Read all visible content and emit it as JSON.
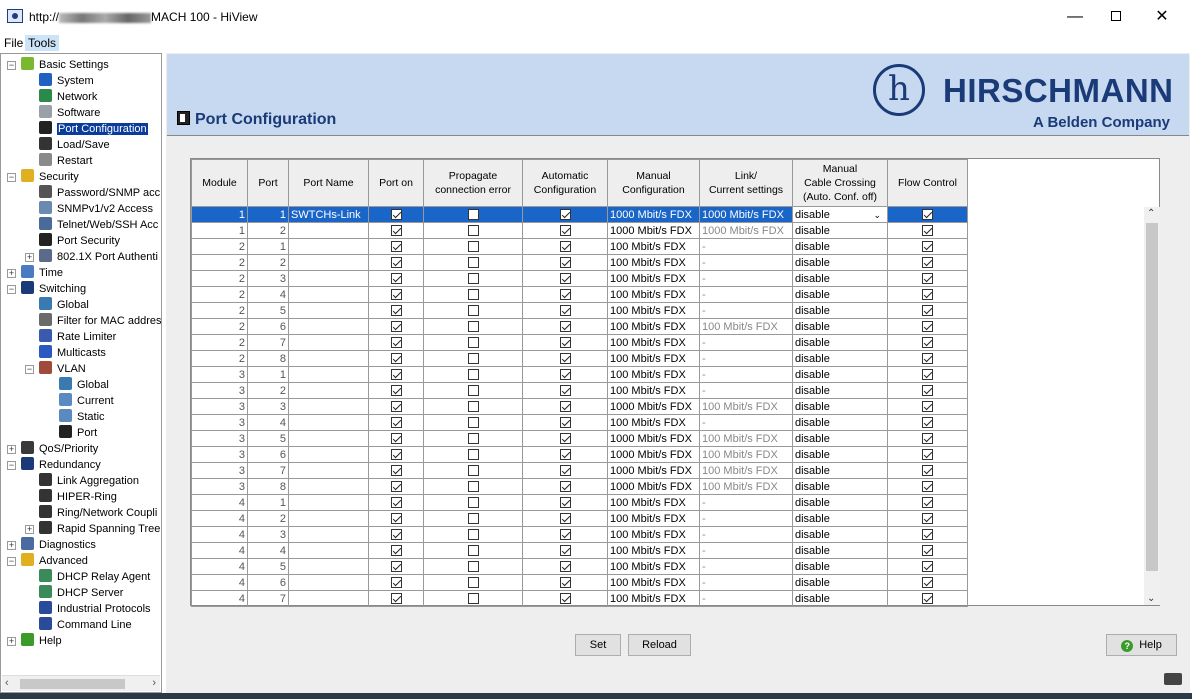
{
  "window": {
    "title_prefix": "http://",
    "title_suffix": "MACH 100 - HiView",
    "minimize": "—",
    "close": "✕"
  },
  "menu": {
    "file": "File",
    "tools": "Tools"
  },
  "tree": [
    {
      "label": "Basic Settings",
      "level": 0,
      "icon": "star-icon",
      "color": "#7cb82f",
      "expander": "−"
    },
    {
      "label": "System",
      "level": 1,
      "icon": "info-icon",
      "color": "#2060c0"
    },
    {
      "label": "Network",
      "level": 1,
      "icon": "network-icon",
      "color": "#2a8a4a"
    },
    {
      "label": "Software",
      "level": 1,
      "icon": "software-icon",
      "color": "#9aa0a8"
    },
    {
      "label": "Port Configuration",
      "level": 1,
      "icon": "port-icon",
      "color": "#222222",
      "selected": true
    },
    {
      "label": "Load/Save",
      "level": 1,
      "icon": "save-icon",
      "color": "#333333"
    },
    {
      "label": "Restart",
      "level": 1,
      "icon": "restart-icon",
      "color": "#8a8a8a"
    },
    {
      "label": "Security",
      "level": 0,
      "icon": "lock-icon",
      "color": "#e0b020",
      "expander": "−"
    },
    {
      "label": "Password/SNMP acc",
      "level": 1,
      "icon": "pin-icon",
      "color": "#555555"
    },
    {
      "label": "SNMPv1/v2 Access",
      "level": 1,
      "icon": "snmp-icon",
      "color": "#6a8ab0"
    },
    {
      "label": "Telnet/Web/SSH Acc",
      "level": 1,
      "icon": "terminal-icon",
      "color": "#4a6a9a"
    },
    {
      "label": "Port Security",
      "level": 1,
      "icon": "port-security-icon",
      "color": "#222222"
    },
    {
      "label": "802.1X Port Authenti",
      "level": 1,
      "icon": "dot1x-icon",
      "color": "#5a6a8a",
      "expander": "+"
    },
    {
      "label": "Time",
      "level": 0,
      "icon": "clock-icon",
      "color": "#4a7ac0",
      "expander": "+"
    },
    {
      "label": "Switching",
      "level": 0,
      "icon": "switching-icon",
      "color": "#1a3a78",
      "expander": "−"
    },
    {
      "label": "Global",
      "level": 1,
      "icon": "global-icon",
      "color": "#3a7ab0"
    },
    {
      "label": "Filter for MAC addres",
      "level": 1,
      "icon": "filter-icon",
      "color": "#6a6a6a"
    },
    {
      "label": "Rate Limiter",
      "level": 1,
      "icon": "rate-limiter-icon",
      "color": "#3a5ab0"
    },
    {
      "label": "Multicasts",
      "level": 1,
      "icon": "multicast-icon",
      "color": "#2a5ac0"
    },
    {
      "label": "VLAN",
      "level": 1,
      "icon": "vlan-icon",
      "color": "#a04a3a",
      "expander": "−"
    },
    {
      "label": "Global",
      "level": 2,
      "icon": "vlan-global-icon",
      "color": "#3a7ab0"
    },
    {
      "label": "Current",
      "level": 2,
      "icon": "vlan-current-icon",
      "color": "#5a8ac0"
    },
    {
      "label": "Static",
      "level": 2,
      "icon": "vlan-static-icon",
      "color": "#5a8ac0"
    },
    {
      "label": "Port",
      "level": 2,
      "icon": "vlan-port-icon",
      "color": "#222222"
    },
    {
      "label": "QoS/Priority",
      "level": 0,
      "icon": "qos-icon",
      "color": "#3a3a3a",
      "expander": "+"
    },
    {
      "label": "Redundancy",
      "level": 0,
      "icon": "redundancy-icon",
      "color": "#1a3a78",
      "expander": "−"
    },
    {
      "label": "Link Aggregation",
      "level": 1,
      "icon": "link-aggregation-icon",
      "color": "#333333"
    },
    {
      "label": "HIPER-Ring",
      "level": 1,
      "icon": "ring-icon",
      "color": "#333333"
    },
    {
      "label": "Ring/Network Coupli",
      "level": 1,
      "icon": "ring-coupling-icon",
      "color": "#333333"
    },
    {
      "label": "Rapid Spanning Tree",
      "level": 1,
      "icon": "spanning-tree-icon",
      "color": "#333333",
      "expander": "+"
    },
    {
      "label": "Diagnostics",
      "level": 0,
      "icon": "diagnostics-icon",
      "color": "#4a6aa0",
      "expander": "+"
    },
    {
      "label": "Advanced",
      "level": 0,
      "icon": "advanced-icon",
      "color": "#e0b020",
      "expander": "−"
    },
    {
      "label": "DHCP Relay Agent",
      "level": 1,
      "icon": "dhcp-relay-icon",
      "color": "#3a8a5a"
    },
    {
      "label": "DHCP Server",
      "level": 1,
      "icon": "dhcp-server-icon",
      "color": "#3a8a5a"
    },
    {
      "label": "Industrial Protocols",
      "level": 1,
      "icon": "protocols-icon",
      "color": "#2a4a9a"
    },
    {
      "label": "Command Line",
      "level": 1,
      "icon": "command-line-icon",
      "color": "#2a4a9a"
    },
    {
      "label": "Help",
      "level": 0,
      "icon": "help-icon",
      "color": "#3a9a2a",
      "expander": "+"
    }
  ],
  "brand": {
    "logo_letter": "h",
    "name": "HIRSCHMANN",
    "subtitle": "A Belden Company"
  },
  "page": {
    "title": "Port Configuration"
  },
  "table": {
    "headers": [
      "Module",
      "Port",
      "Port Name",
      "Port on",
      "Propagate\nconnection error",
      "Automatic\nConfiguration",
      "Manual\nConfiguration",
      "Link/\nCurrent settings",
      "Manual\nCable Crossing\n(Auto. Conf. off)",
      "Flow Control"
    ],
    "rows": [
      {
        "module": "1",
        "port": "1",
        "name": "SWTCHs-Link",
        "port_on": true,
        "propagate": false,
        "auto": true,
        "manual": "1000 Mbit/s FDX",
        "link": "1000 Mbit/s FDX",
        "crossing": "disable",
        "flow": true,
        "selected": true
      },
      {
        "module": "1",
        "port": "2",
        "name": "",
        "port_on": true,
        "propagate": false,
        "auto": true,
        "manual": "1000 Mbit/s FDX",
        "link": "1000 Mbit/s FDX",
        "crossing": "disable",
        "flow": true
      },
      {
        "module": "2",
        "port": "1",
        "name": "",
        "port_on": true,
        "propagate": false,
        "auto": true,
        "manual": "100 Mbit/s FDX",
        "link": "-",
        "crossing": "disable",
        "flow": true
      },
      {
        "module": "2",
        "port": "2",
        "name": "",
        "port_on": true,
        "propagate": false,
        "auto": true,
        "manual": "100 Mbit/s FDX",
        "link": "-",
        "crossing": "disable",
        "flow": true
      },
      {
        "module": "2",
        "port": "3",
        "name": "",
        "port_on": true,
        "propagate": false,
        "auto": true,
        "manual": "100 Mbit/s FDX",
        "link": "-",
        "crossing": "disable",
        "flow": true
      },
      {
        "module": "2",
        "port": "4",
        "name": "",
        "port_on": true,
        "propagate": false,
        "auto": true,
        "manual": "100 Mbit/s FDX",
        "link": "-",
        "crossing": "disable",
        "flow": true
      },
      {
        "module": "2",
        "port": "5",
        "name": "",
        "port_on": true,
        "propagate": false,
        "auto": true,
        "manual": "100 Mbit/s FDX",
        "link": "-",
        "crossing": "disable",
        "flow": true
      },
      {
        "module": "2",
        "port": "6",
        "name": "",
        "port_on": true,
        "propagate": false,
        "auto": true,
        "manual": "100 Mbit/s FDX",
        "link": "100 Mbit/s FDX",
        "crossing": "disable",
        "flow": true
      },
      {
        "module": "2",
        "port": "7",
        "name": "",
        "port_on": true,
        "propagate": false,
        "auto": true,
        "manual": "100 Mbit/s FDX",
        "link": "-",
        "crossing": "disable",
        "flow": true
      },
      {
        "module": "2",
        "port": "8",
        "name": "",
        "port_on": true,
        "propagate": false,
        "auto": true,
        "manual": "100 Mbit/s FDX",
        "link": "-",
        "crossing": "disable",
        "flow": true
      },
      {
        "module": "3",
        "port": "1",
        "name": "",
        "port_on": true,
        "propagate": false,
        "auto": true,
        "manual": "100 Mbit/s FDX",
        "link": "-",
        "crossing": "disable",
        "flow": true
      },
      {
        "module": "3",
        "port": "2",
        "name": "",
        "port_on": true,
        "propagate": false,
        "auto": true,
        "manual": "100 Mbit/s FDX",
        "link": "-",
        "crossing": "disable",
        "flow": true
      },
      {
        "module": "3",
        "port": "3",
        "name": "",
        "port_on": true,
        "propagate": false,
        "auto": true,
        "manual": "1000 Mbit/s FDX",
        "link": "100 Mbit/s FDX",
        "crossing": "disable",
        "flow": true
      },
      {
        "module": "3",
        "port": "4",
        "name": "",
        "port_on": true,
        "propagate": false,
        "auto": true,
        "manual": "100 Mbit/s FDX",
        "link": "-",
        "crossing": "disable",
        "flow": true
      },
      {
        "module": "3",
        "port": "5",
        "name": "",
        "port_on": true,
        "propagate": false,
        "auto": true,
        "manual": "1000 Mbit/s FDX",
        "link": "100 Mbit/s FDX",
        "crossing": "disable",
        "flow": true
      },
      {
        "module": "3",
        "port": "6",
        "name": "",
        "port_on": true,
        "propagate": false,
        "auto": true,
        "manual": "1000 Mbit/s FDX",
        "link": "100 Mbit/s FDX",
        "crossing": "disable",
        "flow": true
      },
      {
        "module": "3",
        "port": "7",
        "name": "",
        "port_on": true,
        "propagate": false,
        "auto": true,
        "manual": "1000 Mbit/s FDX",
        "link": "100 Mbit/s FDX",
        "crossing": "disable",
        "flow": true
      },
      {
        "module": "3",
        "port": "8",
        "name": "",
        "port_on": true,
        "propagate": false,
        "auto": true,
        "manual": "1000 Mbit/s FDX",
        "link": "100 Mbit/s FDX",
        "crossing": "disable",
        "flow": true
      },
      {
        "module": "4",
        "port": "1",
        "name": "",
        "port_on": true,
        "propagate": false,
        "auto": true,
        "manual": "100 Mbit/s FDX",
        "link": "-",
        "crossing": "disable",
        "flow": true
      },
      {
        "module": "4",
        "port": "2",
        "name": "",
        "port_on": true,
        "propagate": false,
        "auto": true,
        "manual": "100 Mbit/s FDX",
        "link": "-",
        "crossing": "disable",
        "flow": true
      },
      {
        "module": "4",
        "port": "3",
        "name": "",
        "port_on": true,
        "propagate": false,
        "auto": true,
        "manual": "100 Mbit/s FDX",
        "link": "-",
        "crossing": "disable",
        "flow": true
      },
      {
        "module": "4",
        "port": "4",
        "name": "",
        "port_on": true,
        "propagate": false,
        "auto": true,
        "manual": "100 Mbit/s FDX",
        "link": "-",
        "crossing": "disable",
        "flow": true
      },
      {
        "module": "4",
        "port": "5",
        "name": "",
        "port_on": true,
        "propagate": false,
        "auto": true,
        "manual": "100 Mbit/s FDX",
        "link": "-",
        "crossing": "disable",
        "flow": true
      },
      {
        "module": "4",
        "port": "6",
        "name": "",
        "port_on": true,
        "propagate": false,
        "auto": true,
        "manual": "100 Mbit/s FDX",
        "link": "-",
        "crossing": "disable",
        "flow": true
      },
      {
        "module": "4",
        "port": "7",
        "name": "",
        "port_on": true,
        "propagate": false,
        "auto": true,
        "manual": "100 Mbit/s FDX",
        "link": "-",
        "crossing": "disable",
        "flow": true
      }
    ]
  },
  "buttons": {
    "set": "Set",
    "reload": "Reload",
    "help": "Help"
  }
}
